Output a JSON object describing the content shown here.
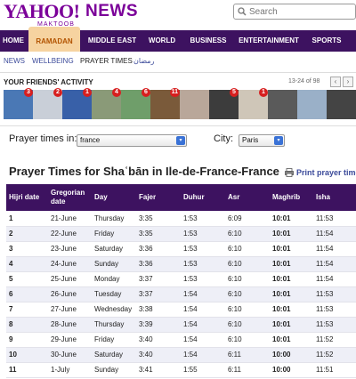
{
  "header": {
    "logo_text": "YAHOO!",
    "logo_sub": "MAKTOOB",
    "section": "NEWS",
    "search_placeholder": "Search"
  },
  "nav": {
    "items": [
      {
        "label": "HOME"
      },
      {
        "label": "RAMADAN",
        "active": true
      },
      {
        "label": "MIDDLE EAST"
      },
      {
        "label": "WORLD"
      },
      {
        "label": "BUSINESS"
      },
      {
        "label": "ENTERTAINMENT"
      },
      {
        "label": "SPORTS"
      }
    ]
  },
  "subnav": {
    "items": [
      {
        "label": "NEWS"
      },
      {
        "label": "WELLBEING"
      },
      {
        "label": "PRAYER TIMES",
        "current": true
      },
      {
        "label": "رمضان"
      }
    ]
  },
  "friends": {
    "title": "YOUR FRIENDS' ACTIVITY",
    "count": "13-24 of 98",
    "prev": "‹",
    "next": "›",
    "thumbs": [
      {
        "badge": "3",
        "color": "#4a78b5"
      },
      {
        "badge": "2",
        "color": "#c9cfd8"
      },
      {
        "badge": "1",
        "color": "#3860a8"
      },
      {
        "badge": "4",
        "color": "#8a9a78"
      },
      {
        "badge": "6",
        "color": "#6f9e6a"
      },
      {
        "badge": "11",
        "color": "#7a5a3a"
      },
      {
        "badge": "",
        "color": "#b9a79a"
      },
      {
        "badge": "5",
        "color": "#3c3c3c"
      },
      {
        "badge": "1",
        "color": "#cfc6b8"
      },
      {
        "badge": "",
        "color": "#5a5a5a"
      },
      {
        "badge": "",
        "color": "#9ab0c8"
      },
      {
        "badge": "",
        "color": "#444444"
      }
    ]
  },
  "selection": {
    "prayer_label": "Prayer times in:",
    "country_value": "france",
    "city_label": "City:",
    "city_value": "Paris"
  },
  "page_title": "Prayer Times for Shaʿbān in Ile-de-France-France",
  "print_label": "Print prayer times",
  "table": {
    "columns": [
      "Hijri date",
      "Gregorian date",
      "Day",
      "Fajer",
      "Duhur",
      "Asr",
      "Maghrib",
      "Isha"
    ],
    "rows": [
      [
        "1",
        "21-June",
        "Thursday",
        "3:35",
        "1:53",
        "6:09",
        "10:01",
        "11:53"
      ],
      [
        "2",
        "22-June",
        "Friday",
        "3:35",
        "1:53",
        "6:10",
        "10:01",
        "11:54"
      ],
      [
        "3",
        "23-June",
        "Saturday",
        "3:36",
        "1:53",
        "6:10",
        "10:01",
        "11:54"
      ],
      [
        "4",
        "24-June",
        "Sunday",
        "3:36",
        "1:53",
        "6:10",
        "10:01",
        "11:54"
      ],
      [
        "5",
        "25-June",
        "Monday",
        "3:37",
        "1:53",
        "6:10",
        "10:01",
        "11:54"
      ],
      [
        "6",
        "26-June",
        "Tuesday",
        "3:37",
        "1:54",
        "6:10",
        "10:01",
        "11:53"
      ],
      [
        "7",
        "27-June",
        "Wednesday",
        "3:38",
        "1:54",
        "6:10",
        "10:01",
        "11:53"
      ],
      [
        "8",
        "28-June",
        "Thursday",
        "3:39",
        "1:54",
        "6:10",
        "10:01",
        "11:53"
      ],
      [
        "9",
        "29-June",
        "Friday",
        "3:40",
        "1:54",
        "6:10",
        "10:01",
        "11:52"
      ],
      [
        "10",
        "30-June",
        "Saturday",
        "3:40",
        "1:54",
        "6:11",
        "10:00",
        "11:52"
      ],
      [
        "11",
        "1-July",
        "Sunday",
        "3:41",
        "1:55",
        "6:11",
        "10:00",
        "11:51"
      ]
    ]
  },
  "colors": {
    "brand_purple": "#7b0099",
    "nav_bg": "#3d1260",
    "active_tab_bg": "#f6d3a0",
    "active_tab_text": "#b25300",
    "link_blue": "#3b4a9a",
    "badge_red": "#d71f1f"
  }
}
